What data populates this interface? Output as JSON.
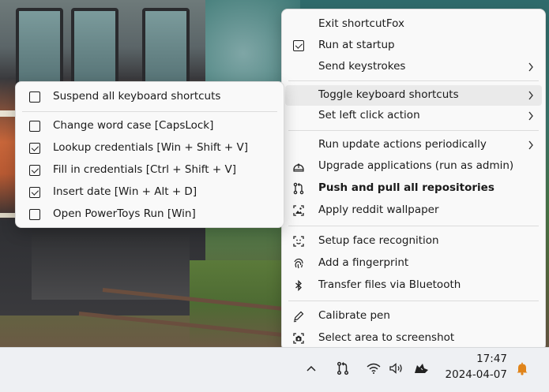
{
  "main_menu": {
    "items": [
      {
        "label": "Exit shortcutFox"
      },
      {
        "label": "Run at startup"
      },
      {
        "label": "Send keystrokes"
      },
      {
        "label": "Toggle keyboard shortcuts"
      },
      {
        "label": "Set left click action"
      },
      {
        "label": "Run update actions periodically"
      },
      {
        "label": "Upgrade applications (run as admin)"
      },
      {
        "label": "Push and pull all repositories"
      },
      {
        "label": "Apply reddit wallpaper"
      },
      {
        "label": "Setup face recognition"
      },
      {
        "label": "Add a fingerprint"
      },
      {
        "label": "Transfer files via Bluetooth"
      },
      {
        "label": "Calibrate pen"
      },
      {
        "label": "Select area to screenshot"
      }
    ],
    "run_at_startup_checked": true,
    "highlighted_item": "Toggle keyboard shortcuts"
  },
  "sub_menu": {
    "items": [
      {
        "label": "Suspend all keyboard shortcuts",
        "checked": false
      },
      {
        "label": "Change word case [CapsLock]",
        "checked": false
      },
      {
        "label": "Lookup credentials [Win + Shift + V]",
        "checked": true
      },
      {
        "label": "Fill in credentials [Ctrl + Shift + V]",
        "checked": true
      },
      {
        "label": "Insert date [Win + Alt + D]",
        "checked": true
      },
      {
        "label": "Open PowerToys Run [Win]",
        "checked": false
      }
    ]
  },
  "taskbar": {
    "time": "17:47",
    "date": "2024-04-07",
    "tray_icons": [
      "chevron-up-icon",
      "git-pull-icon",
      "wifi-icon",
      "volume-icon",
      "fox-app-icon",
      "notification-bell-icon"
    ],
    "bell_color": "#e0841a"
  }
}
